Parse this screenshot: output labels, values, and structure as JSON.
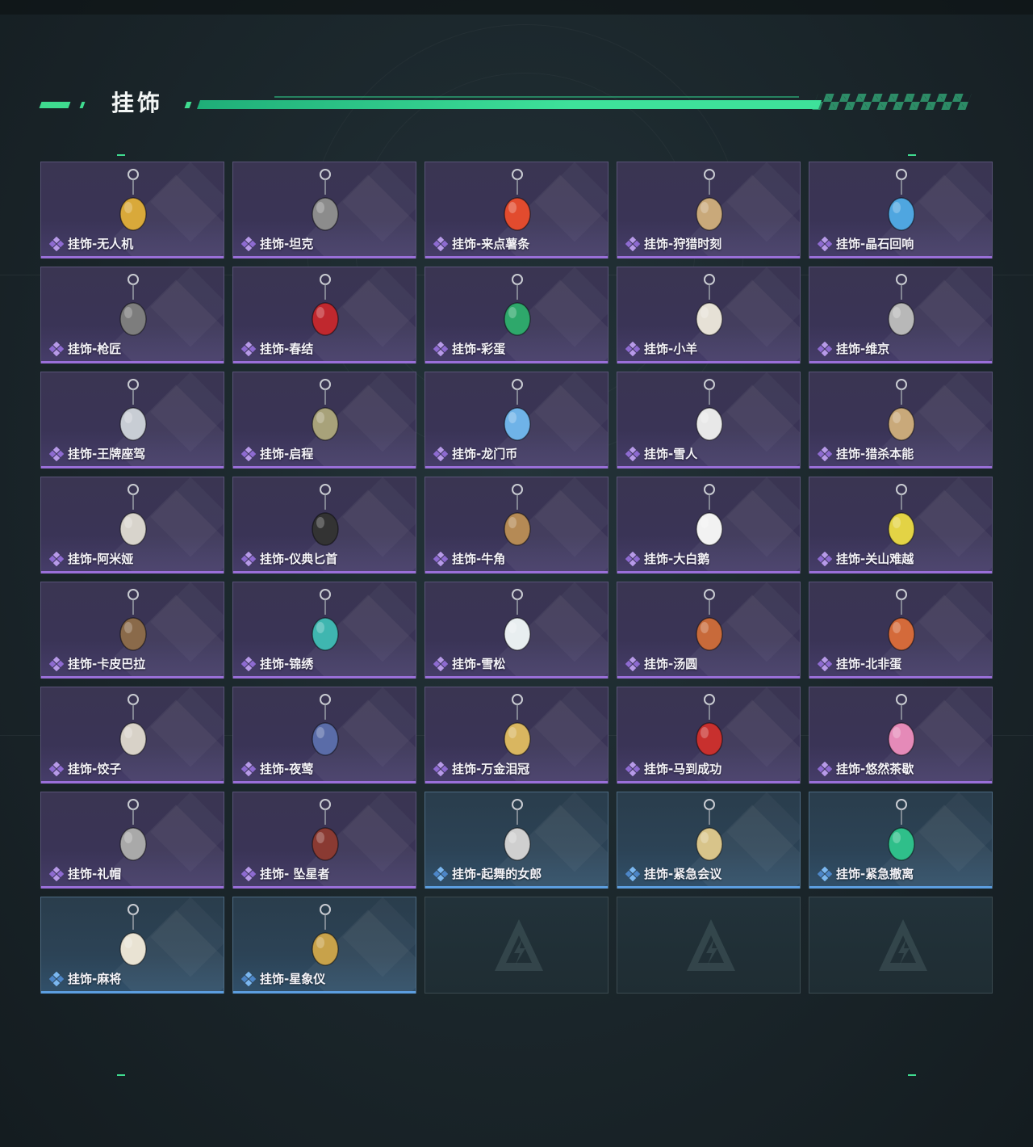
{
  "section": {
    "title": "挂饰"
  },
  "colors": {
    "accent": "#3fdb8f",
    "purple_strip": "#9a6fd9",
    "blue_strip": "#5c9ee0"
  },
  "items": [
    {
      "name": "挂饰-无人机",
      "rarity": "purple",
      "icon": "drone-charm-icon"
    },
    {
      "name": "挂饰-坦克",
      "rarity": "purple",
      "icon": "tank-charm-icon"
    },
    {
      "name": "挂饰-来点薯条",
      "rarity": "purple",
      "icon": "fries-charm-icon"
    },
    {
      "name": "挂饰-狩猎时刻",
      "rarity": "purple",
      "icon": "antler-charm-icon"
    },
    {
      "name": "挂饰-晶石回响",
      "rarity": "purple",
      "icon": "crystal-charm-icon"
    },
    {
      "name": "挂饰-枪匠",
      "rarity": "purple",
      "icon": "gunsmith-charm-icon"
    },
    {
      "name": "挂饰-春结",
      "rarity": "purple",
      "icon": "chinese-knot-charm-icon"
    },
    {
      "name": "挂饰-彩蛋",
      "rarity": "purple",
      "icon": "egg-charm-icon"
    },
    {
      "name": "挂饰-小羊",
      "rarity": "purple",
      "icon": "lamb-charm-icon"
    },
    {
      "name": "挂饰-维京",
      "rarity": "purple",
      "icon": "viking-hammer-charm-icon"
    },
    {
      "name": "挂饰-王牌座驾",
      "rarity": "purple",
      "icon": "jet-charm-icon"
    },
    {
      "name": "挂饰-启程",
      "rarity": "purple",
      "icon": "emblem-charm-icon"
    },
    {
      "name": "挂饰-龙门币",
      "rarity": "purple",
      "icon": "coin-charm-icon"
    },
    {
      "name": "挂饰-雪人",
      "rarity": "purple",
      "icon": "snowman-charm-icon"
    },
    {
      "name": "挂饰-猎杀本能",
      "rarity": "purple",
      "icon": "antler-charm-icon"
    },
    {
      "name": "挂饰-阿米娅",
      "rarity": "purple",
      "icon": "rabbit-charm-icon"
    },
    {
      "name": "挂饰-仪典匕首",
      "rarity": "purple",
      "icon": "dagger-charm-icon"
    },
    {
      "name": "挂饰-牛角",
      "rarity": "purple",
      "icon": "bull-horn-charm-icon"
    },
    {
      "name": "挂饰-大白鹅",
      "rarity": "purple",
      "icon": "goose-charm-icon"
    },
    {
      "name": "挂饰-关山难越",
      "rarity": "purple",
      "icon": "yellow-bottle-charm-icon"
    },
    {
      "name": "挂饰-卡皮巴拉",
      "rarity": "purple",
      "icon": "capybara-charm-icon"
    },
    {
      "name": "挂饰-锦绣",
      "rarity": "purple",
      "icon": "butterfly-charm-icon"
    },
    {
      "name": "挂饰-雪松",
      "rarity": "purple",
      "icon": "pine-tree-charm-icon"
    },
    {
      "name": "挂饰-汤圆",
      "rarity": "purple",
      "icon": "dumpling-bowl-charm-icon"
    },
    {
      "name": "挂饰-北非蛋",
      "rarity": "purple",
      "icon": "shakshuka-charm-icon"
    },
    {
      "name": "挂饰-饺子",
      "rarity": "purple",
      "icon": "dumpling-plate-charm-icon"
    },
    {
      "name": "挂饰-夜莺",
      "rarity": "purple",
      "icon": "feather-charm-icon"
    },
    {
      "name": "挂饰-万金泪冠",
      "rarity": "purple",
      "icon": "burger-charm-icon"
    },
    {
      "name": "挂饰-马到成功",
      "rarity": "purple",
      "icon": "horse-charm-icon"
    },
    {
      "name": "挂饰-悠然茶歇",
      "rarity": "purple",
      "icon": "cupcake-charm-icon"
    },
    {
      "name": "挂饰-礼帽",
      "rarity": "purple",
      "icon": "fedora-charm-icon"
    },
    {
      "name": "挂饰- 坠星者",
      "rarity": "purple",
      "icon": "triangle-charm-icon"
    },
    {
      "name": "挂饰-起舞的女郎",
      "rarity": "blue",
      "icon": "dancer-charm-icon"
    },
    {
      "name": "挂饰-紧急会议",
      "rarity": "blue",
      "icon": "meeting-charm-icon"
    },
    {
      "name": "挂饰-紧急撤离",
      "rarity": "blue",
      "icon": "evac-charm-icon"
    },
    {
      "name": "挂饰-麻将",
      "rarity": "blue",
      "icon": "mahjong-charm-icon"
    },
    {
      "name": "挂饰-星象仪",
      "rarity": "blue",
      "icon": "astrolabe-charm-icon"
    }
  ],
  "empty_slots": 3
}
